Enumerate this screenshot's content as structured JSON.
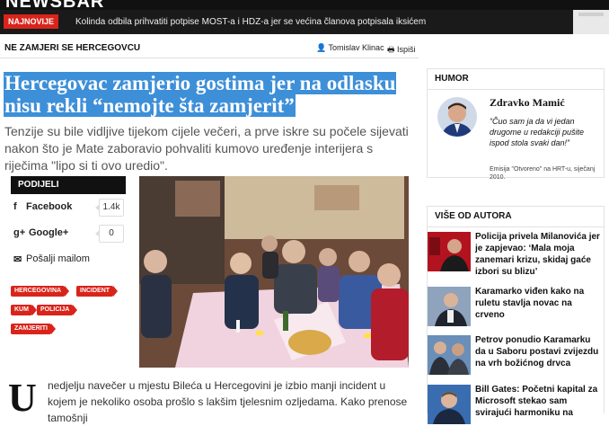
{
  "site": {
    "logo": "NEWSBAR"
  },
  "ticker": {
    "badge": "NAJNOVIJE",
    "headline": "Kolinda odbila prihvatiti potpise MOST-a i HDZ-a jer se većina članova potpisala iksićem"
  },
  "article": {
    "section": "NE ZAMJERI SE HERCEGOVCU",
    "author": "Tomislav Klinac",
    "print_label": "Ispiši",
    "title": "Hercegovac zamjerio gostima jer na odlasku nisu rekli “nemojte šta zamjerit”",
    "lead": "Tenzije su bile vidljive tijekom cijele večeri, a prve iskre su počele sijevati nakon što je Mate zaboravio pohvaliti kumovo uređenje interijera s riječima \"lipo si ti ovo uredio\".",
    "dropcap": "U",
    "body": "nedjelju navečer u mjestu Bileća u Hercegovini je izbio manji incident u kojem je nekoliko osoba prošlo s lakšim tjelesnim ozljedama. Kako prenose tamošnji"
  },
  "share": {
    "header": "PODIJELI",
    "facebook": {
      "label": "Facebook",
      "count": "1.4k"
    },
    "google": {
      "label": "Google+",
      "count": "0"
    },
    "mail": {
      "label": "Pošalji mailom"
    }
  },
  "tags": [
    "HERCEGOVINA",
    "INCIDENT",
    "KUM",
    "POLICIJA",
    "ZAMJERITI"
  ],
  "sidebar": {
    "humor": {
      "header": "HUMOR",
      "name": "Zdravko Mamić",
      "quote": "“Čuo sam ja da vi jedan drugome u redakciji pušite ispod stola svaki dan!”",
      "source": "Emisija \"Otvoreno\" na HRT-u, siječanj 2010."
    },
    "more": {
      "header": "VIŠE OD AUTORA",
      "items": [
        "Policija privela Milanovića jer je zapjevao: ‘Mala moja zanemari krizu, skidaj gaće izbori su blizu’",
        "Karamarko viđen kako na ruletu stavlja novac na crveno",
        "Petrov ponudio Karamarku da u Saboru postavi zvijezdu na vrh božićnog drvca",
        "Bill Gates: Početni kapital za Microsoft stekao sam svirajući harmoniku na"
      ]
    }
  },
  "colors": {
    "accent_red": "#d9241b",
    "highlight_blue": "#3d8fd8",
    "dark": "#111111"
  }
}
